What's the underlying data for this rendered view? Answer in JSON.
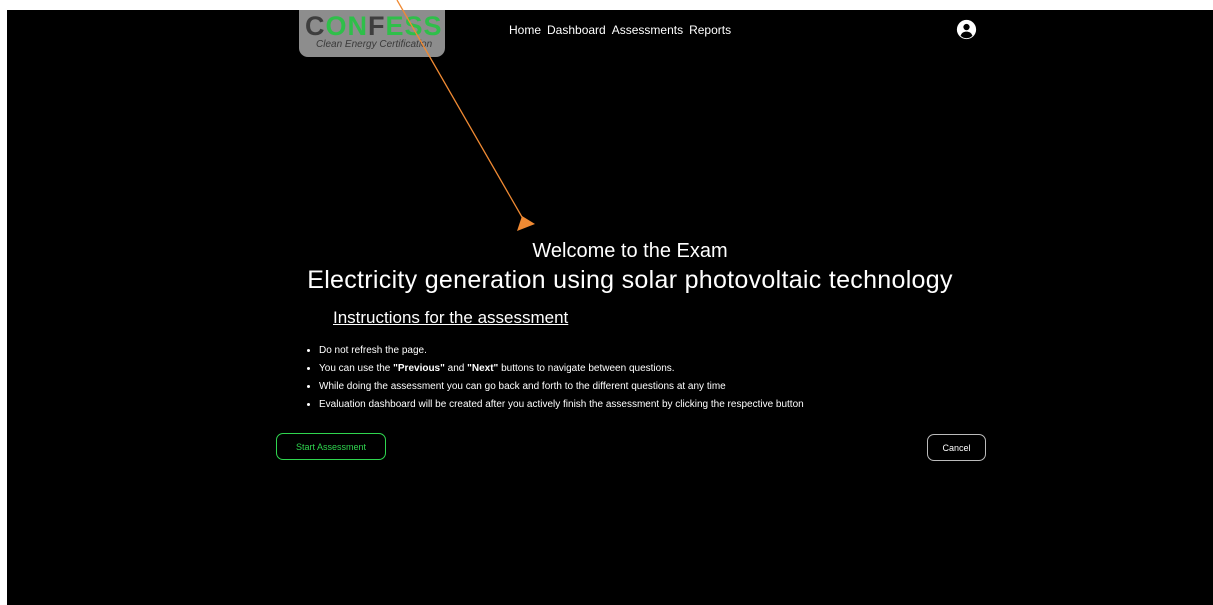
{
  "brand": {
    "letters": [
      "C",
      "ON",
      "F",
      "ESS"
    ],
    "tagline": "Clean Energy Certification"
  },
  "nav": {
    "items": [
      "Home",
      "Dashboard",
      "Assessments",
      "Reports"
    ]
  },
  "main": {
    "welcome": "Welcome to the Exam",
    "course_title": "Electricity generation using solar photovoltaic technology",
    "instructions_heading": "Instructions for the assessment",
    "instructions": [
      {
        "before": "Do not refresh the page.",
        "b1": "",
        "mid": "",
        "b2": "",
        "after": ""
      },
      {
        "before": "You can use the ",
        "b1": "\"Previous\"",
        "mid": " and ",
        "b2": "\"Next\"",
        "after": " buttons to navigate between questions."
      },
      {
        "before": "While doing the assessment you can go back and forth to the different questions at any time",
        "b1": "",
        "mid": "",
        "b2": "",
        "after": ""
      },
      {
        "before": "Evaluation dashboard will be created after you actively finish the assessment by clicking the respective button",
        "b1": "",
        "mid": "",
        "b2": "",
        "after": ""
      }
    ]
  },
  "buttons": {
    "start": "Start Assessment",
    "cancel": "Cancel"
  },
  "colors": {
    "accent_green": "#2fd54f",
    "annotation_arrow": "#f08a33",
    "background": "#000000"
  }
}
